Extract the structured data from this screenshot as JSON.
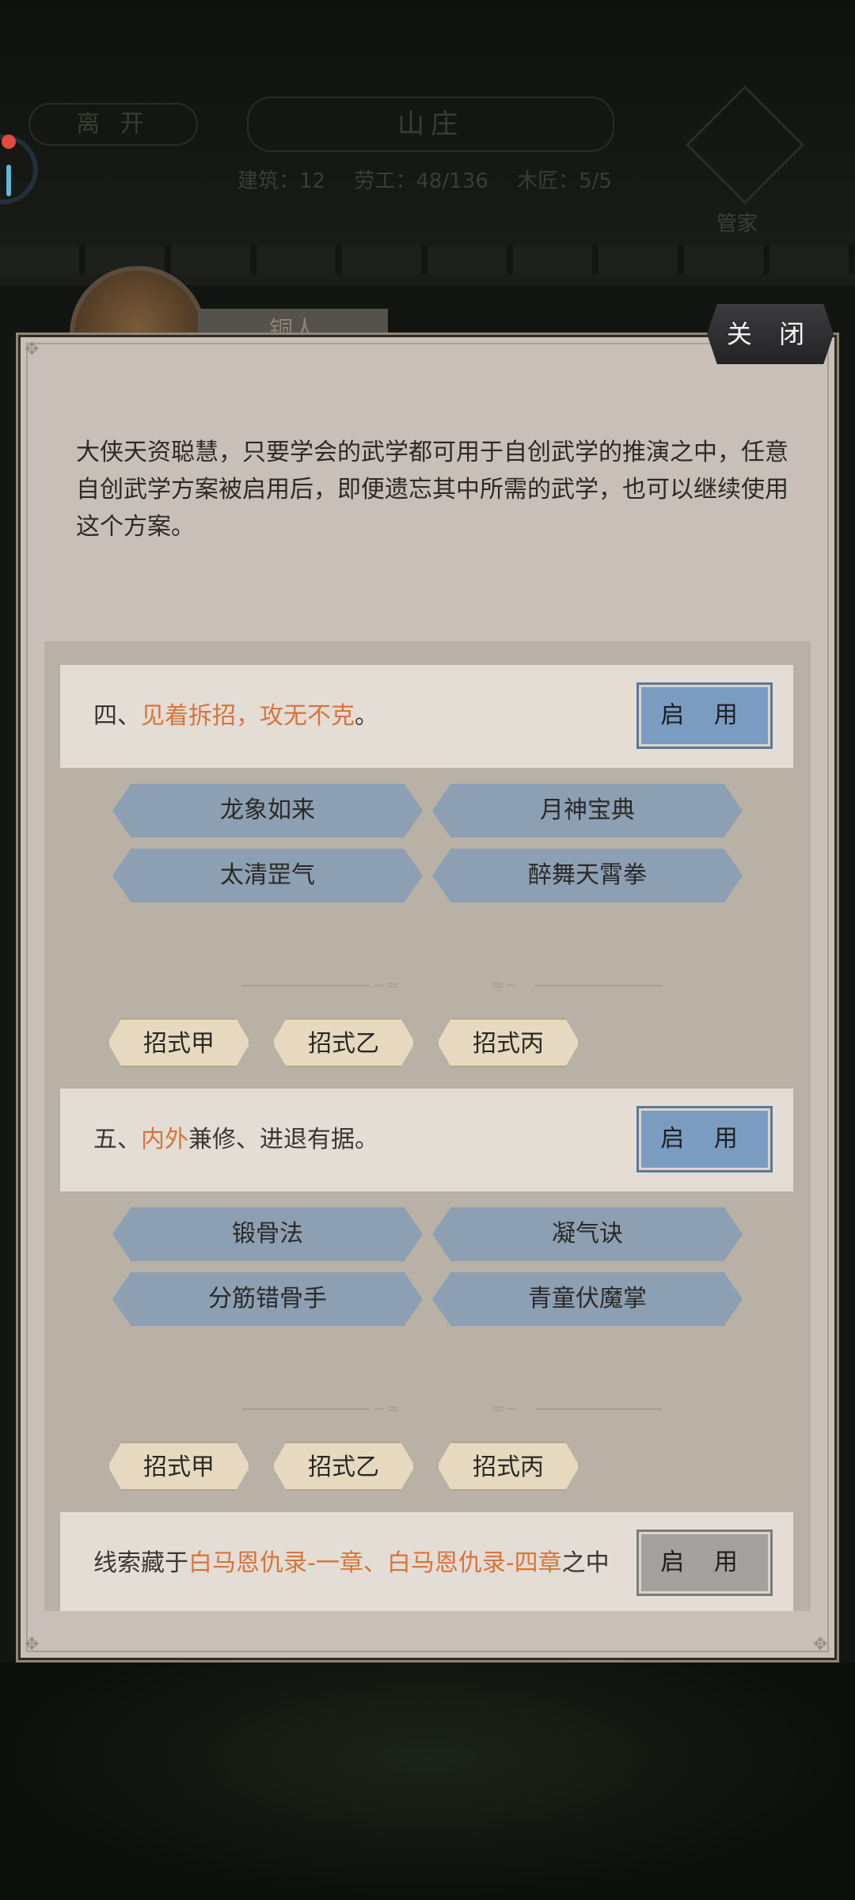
{
  "header": {
    "leave_label": "离 开",
    "title": "山庄",
    "stats": [
      "建筑：12",
      "劳工：48/136",
      "木匠：5/5"
    ],
    "steward_label": "管家"
  },
  "character": {
    "tab_label": "铜人"
  },
  "dialog": {
    "close_label": "关 闭",
    "intro": "大侠天资聪慧，只要学会的武学都可用于自创武学的推演之中，任意自创武学方案被启用后，即便遗忘其中所需的武学，也可以继续使用这个方案。",
    "plans": [
      {
        "prefix": "四、",
        "highlight": "见着拆招，攻无不克",
        "suffix": "。",
        "enable_label": "启 用",
        "skills": [
          "龙象如来",
          "月神宝典",
          "太清罡气",
          "醉舞天霄拳"
        ],
        "moves": [
          "招式甲",
          "招式乙",
          "招式丙"
        ]
      },
      {
        "prefix": "五、",
        "highlight": "内外",
        "suffix": "兼修、进退有据。",
        "enable_label": "启 用",
        "skills": [
          "锻骨法",
          "凝气诀",
          "分筋错骨手",
          "青童伏魔掌"
        ],
        "moves": [
          "招式甲",
          "招式乙",
          "招式丙"
        ]
      }
    ],
    "clue": {
      "prefix": "线索藏于",
      "highlight": "白马恩仇录-一章、白马恩仇录-四章",
      "suffix": "之中",
      "enable_label": "启 用"
    }
  },
  "colors": {
    "highlight": "#d9743b",
    "enable_active": "#7b9cc1",
    "enable_disabled": "#a3a19e",
    "skill_bg": "#8d9fb2"
  }
}
